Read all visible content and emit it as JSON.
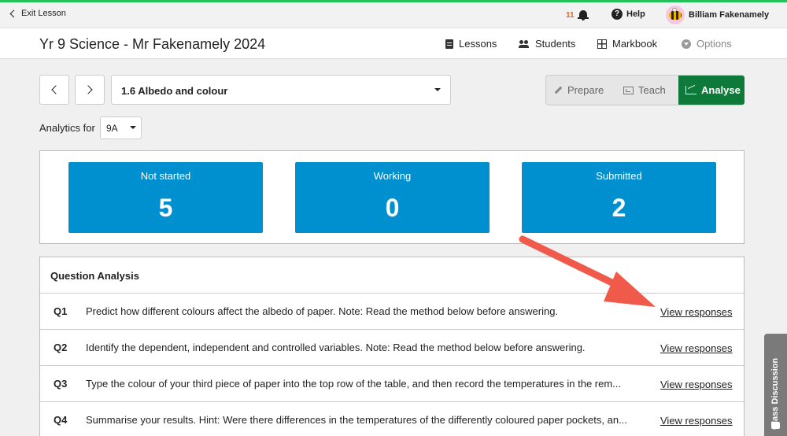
{
  "topbar": {
    "exit_label": "Exit Lesson",
    "notification_count": "11",
    "help_label": "Help",
    "user_name": "Billiam Fakenamely"
  },
  "header": {
    "course_title": "Yr 9 Science - Mr Fakenamely 2024",
    "nav": [
      {
        "label": "Lessons",
        "icon": "document-icon"
      },
      {
        "label": "Students",
        "icon": "people-icon"
      },
      {
        "label": "Markbook",
        "icon": "grid-icon"
      },
      {
        "label": "Options",
        "icon": "chevron-circle-icon",
        "disabled": true
      }
    ]
  },
  "lesson_select": {
    "value": "1.6 Albedo and colour"
  },
  "modes": [
    {
      "label": "Prepare",
      "icon": "pencil-icon"
    },
    {
      "label": "Teach",
      "icon": "whiteboard-icon"
    },
    {
      "label": "Analyse",
      "icon": "line-chart-icon",
      "active": true
    }
  ],
  "analytics": {
    "label": "Analytics for",
    "class_value": "9A"
  },
  "stats": [
    {
      "label": "Not started",
      "value": "5"
    },
    {
      "label": "Working",
      "value": "0"
    },
    {
      "label": "Submitted",
      "value": "2"
    }
  ],
  "question_analysis": {
    "title": "Question Analysis",
    "link_label": "View responses",
    "questions": [
      {
        "num": "Q1",
        "text": "Predict how different colours affect the albedo of paper. Note: Read the method below before answering."
      },
      {
        "num": "Q2",
        "text": "Identify the dependent, independent and controlled variables. Note: Read the method below before answering."
      },
      {
        "num": "Q3",
        "text": "Type the colour of your third piece of paper into the top row of the table, and then record the temperatures in the rem..."
      },
      {
        "num": "Q4",
        "text": "Summarise your results. Hint: Were there differences in the temperatures of the differently coloured paper pockets, an..."
      }
    ]
  },
  "class_discussion": {
    "label": "Class Discussion"
  },
  "colors": {
    "accent_green": "#0d7a3a",
    "stat_blue": "#0090d0",
    "annotation_arrow": "#f05a4a",
    "notification": "#e8622c"
  }
}
